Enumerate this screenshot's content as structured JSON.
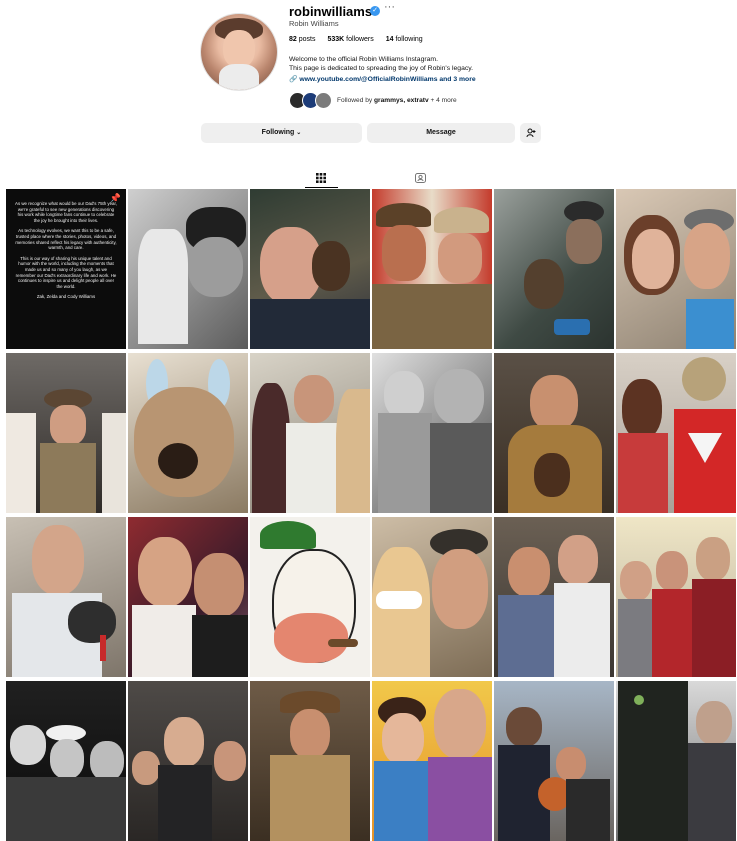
{
  "profile": {
    "username": "robinwilliams",
    "verified_icon": "verified-badge-icon",
    "more_glyph": "···",
    "full_name": "Robin Williams",
    "posts": "82",
    "posts_label": "posts",
    "followers": "533K",
    "followers_label": "followers",
    "following": "14",
    "following_label": "following",
    "bio_line1": "Welcome to the official Robin Williams Instagram.",
    "bio_line2": "This page is dedicated to spreading the joy of Robin's legacy.",
    "link": "www.youtube.com/@OfficialRobinWilliams and 3 more",
    "followed_by_prefix": "Followed by ",
    "followed_by_names": "grammys, extratv",
    "followed_by_more": " + 4 more"
  },
  "actions": {
    "following": "Following",
    "message": "Message",
    "suggest_icon": "add-person-icon"
  },
  "tabs": {
    "posts_icon": "grid-icon",
    "tagged_icon": "tagged-icon"
  },
  "pinned_post": {
    "p1": "As we recognize what would be our Dad's 75th year, we're grateful to see new generations discovering his work while longtime fans continue to celebrate the joy he brought into their lives.",
    "p2": "As technology evolves, we want this to be a safe, trusted place where the stories, photos, videos, and memories shared reflect his legacy with authenticity, warmth, and care.",
    "p3": "This is our way of sharing his unique talent and humor with the world, including the moments that made us and so many of you laugh, as we remember our Dad's extraordinary life and work. He continues to inspire us and delight people all over the world.",
    "p4": "Zak, Zelda and Cody Williams"
  },
  "colors": {
    "accent_link": "#00376b",
    "verified": "#3897f0",
    "button_bg": "#efefef"
  }
}
